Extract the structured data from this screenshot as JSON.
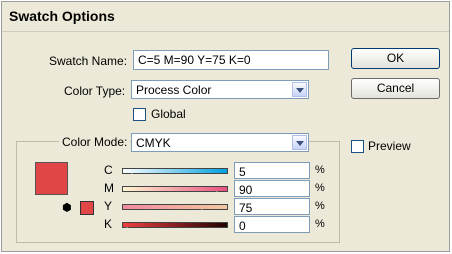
{
  "dialog": {
    "title": "Swatch Options",
    "swatch_name_label": "Swatch Name:",
    "swatch_name_value": "C=5 M=90 Y=75 K=0",
    "color_type_label": "Color Type:",
    "color_type_value": "Process Color",
    "global_label": "Global",
    "global_checked": false,
    "color_mode_label": "Color Mode:",
    "color_mode_value": "CMYK",
    "preview_label": "Preview",
    "preview_checked": false,
    "ok_label": "OK",
    "cancel_label": "Cancel",
    "swatch_color": "#e04646"
  },
  "channels": [
    {
      "label": "C",
      "value": "5",
      "unit": "%",
      "fraction": 0.05
    },
    {
      "label": "M",
      "value": "90",
      "unit": "%",
      "fraction": 0.9
    },
    {
      "label": "Y",
      "value": "75",
      "unit": "%",
      "fraction": 0.75
    },
    {
      "label": "K",
      "value": "0",
      "unit": "%",
      "fraction": 0.0
    }
  ]
}
